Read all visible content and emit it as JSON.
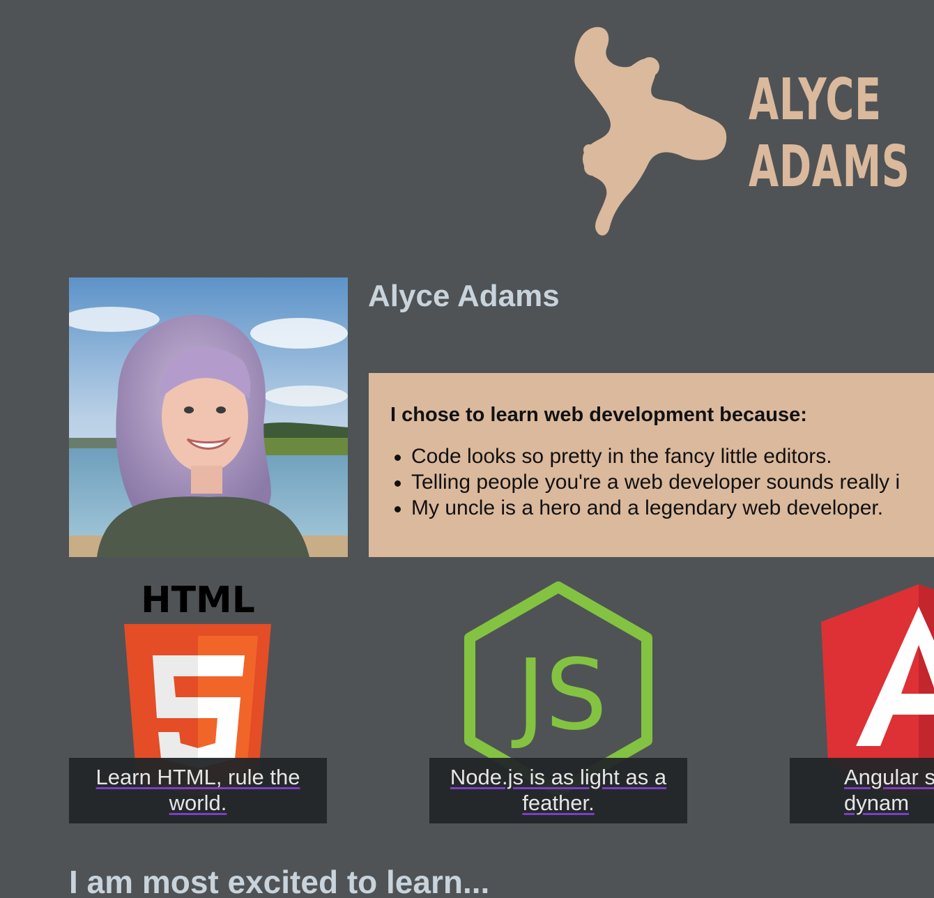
{
  "header": {
    "logo_line1": "ALYCE",
    "logo_line2": "ADAMS",
    "logo_color": "#dbb99c"
  },
  "profile": {
    "name": "Alyce Adams",
    "photo_alt": "Alyce Adams portrait"
  },
  "reasons": {
    "heading": "I chose to learn web development because:",
    "items": [
      "Code looks so pretty in the fancy little editors.",
      "Telling people you're a web developer sounds really i",
      "My uncle is a hero and a legendary web developer."
    ]
  },
  "technologies": [
    {
      "icon": "html5-icon",
      "caption_line1": "Learn HTML, rule the",
      "caption_line2": "world."
    },
    {
      "icon": "nodejs-icon",
      "caption_line1": "Node.js is as light as a",
      "caption_line2": "feather."
    },
    {
      "icon": "angular-icon",
      "caption_line1": "Angular s",
      "caption_line2": "dynam"
    }
  ],
  "html5_logo_label": "HTML",
  "html5_digit": "5",
  "nodejs_logo_label": "JS",
  "section": {
    "heading": "I am most excited to learn..."
  }
}
